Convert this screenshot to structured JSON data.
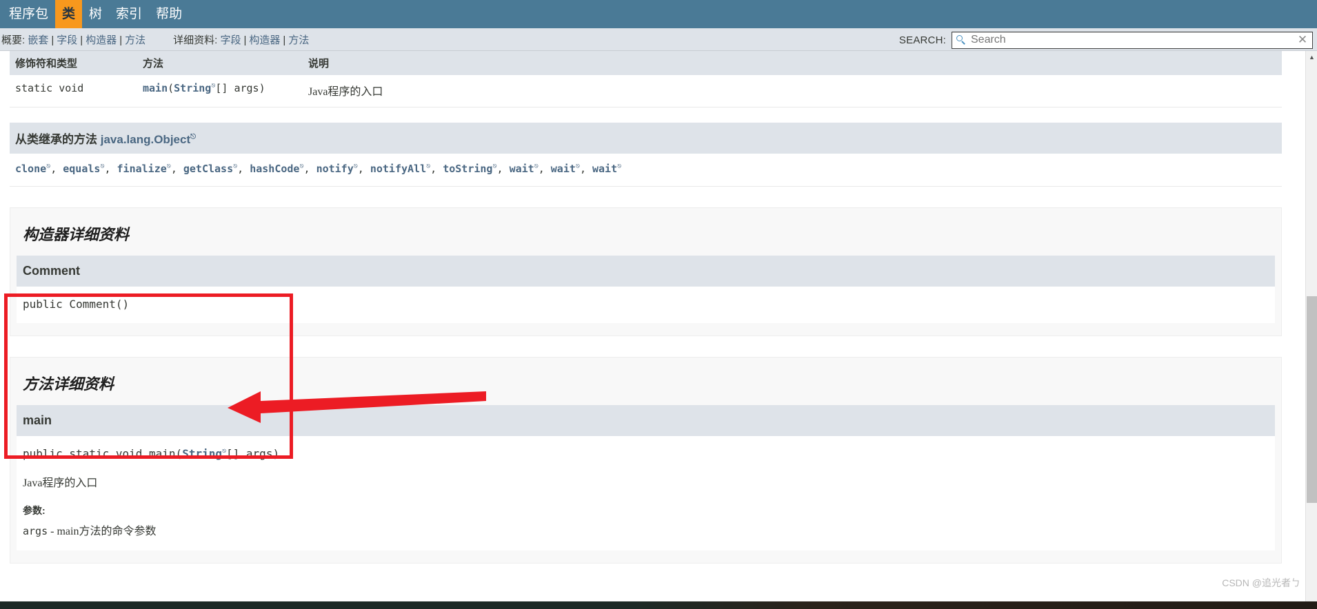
{
  "topnav": {
    "items": [
      {
        "label": "程序包",
        "active": false
      },
      {
        "label": "类",
        "active": true
      },
      {
        "label": "树",
        "active": false
      },
      {
        "label": "索引",
        "active": false
      },
      {
        "label": "帮助",
        "active": false
      }
    ]
  },
  "subnav": {
    "summary_label": "概要:",
    "summary_links": [
      "嵌套",
      "字段",
      "构造器",
      "方法"
    ],
    "detail_label": "详细资料:",
    "detail_links": [
      "字段",
      "构造器",
      "方法"
    ],
    "separator": "|"
  },
  "search": {
    "label": "SEARCH:",
    "placeholder": "Search",
    "value": "",
    "icon": "search-icon",
    "reset_icon": "close-icon",
    "reset_glyph": "✕"
  },
  "method_summary": {
    "headers": [
      "修饰符和类型",
      "方法",
      "说明"
    ],
    "rows": [
      {
        "modifier": "static void",
        "method_name": "main",
        "method_paren_open": "(",
        "method_type": "String",
        "method_rest": "[] args)",
        "description": "Java程序的入口"
      }
    ]
  },
  "inherited": {
    "prefix": "从类继承的方法 ",
    "class": "java.lang.Object",
    "methods": [
      "clone",
      "equals",
      "finalize",
      "getClass",
      "hashCode",
      "notify",
      "notifyAll",
      "toString",
      "wait",
      "wait",
      "wait"
    ],
    "separator": ", "
  },
  "constructor_detail": {
    "title": "构造器详细资料",
    "member_name": "Comment",
    "signature": "public Comment()"
  },
  "method_detail": {
    "title": "方法详细资料",
    "member_name": "main",
    "sig_prefix": "public static void main(",
    "sig_type": "String",
    "sig_suffix": "[] args)",
    "description": "Java程序的入口",
    "params_label": "参数:",
    "param_name": "args",
    "param_dash": " - ",
    "param_desc": "main方法的命令参数"
  },
  "annotation": {
    "box_color": "#ec1c24",
    "arrow_color": "#ec1c24"
  },
  "watermark": {
    "text": "CSDN @追光者ㄅ"
  },
  "scrollbar": {
    "up_glyph": "▲",
    "down_glyph": "▼"
  },
  "colors": {
    "navbar": "#4a7a96",
    "nav_active": "#f8981d",
    "subnav": "#dee3e9",
    "link": "#4a6782"
  }
}
